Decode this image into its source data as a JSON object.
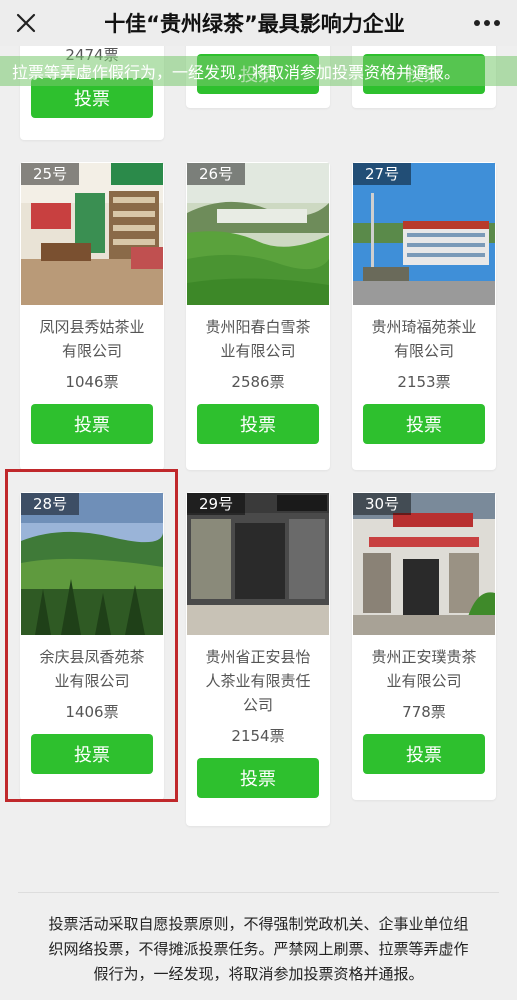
{
  "header": {
    "title": "十佳“贵州绿茶”最具影响力企业",
    "close_icon": "close-icon",
    "more_icon": "more-icon"
  },
  "marquee": {
    "text": "拉票等弄虚作假行为，一经发现，将取消参加投票资格并通报。"
  },
  "top_row": {
    "partial_votes": "2474票",
    "button_label": "投票"
  },
  "candidates": [
    {
      "number": "25号",
      "name_lines": [
        "凤冈县秀姑茶业",
        "有限公司"
      ],
      "votes": "1046票",
      "button": "投票"
    },
    {
      "number": "26号",
      "name_lines": [
        "贵州阳春白雪茶",
        "业有限公司"
      ],
      "votes": "2586票",
      "button": "投票"
    },
    {
      "number": "27号",
      "name_lines": [
        "贵州琦福苑茶业",
        "有限公司"
      ],
      "votes": "2153票",
      "button": "投票"
    },
    {
      "number": "28号",
      "name_lines": [
        "余庆县凤香苑茶",
        "业有限公司"
      ],
      "votes": "1406票",
      "button": "投票"
    },
    {
      "number": "29号",
      "name_lines": [
        "贵州省正安县怡",
        "人茶业有限责任",
        "公司"
      ],
      "votes": "2154票",
      "button": "投票"
    },
    {
      "number": "30号",
      "name_lines": [
        "贵州正安璞贵茶",
        "业有限公司"
      ],
      "votes": "778票",
      "button": "投票"
    }
  ],
  "footer": {
    "notice_lines": [
      "投票活动采取自愿投票原则，不得强制党政机关、企事业单位组",
      "织网络投票，不得摊派投票任务。严禁网上刷票、拉票等弄虚作",
      "假行为，一经发现，将取消参加投票资格并通报。"
    ]
  },
  "colors": {
    "accent_green": "#2ec02e",
    "highlight_red": "#c0282b"
  }
}
